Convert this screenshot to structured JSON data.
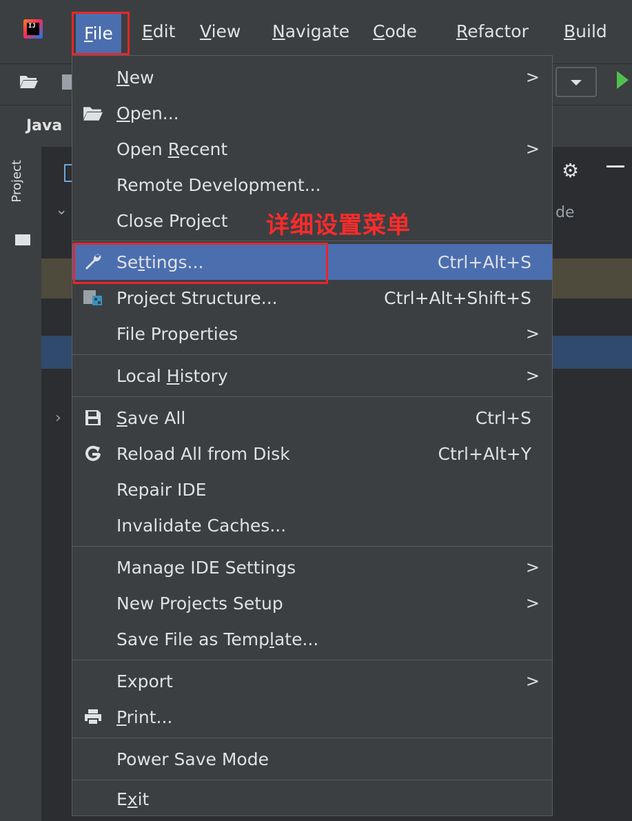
{
  "menubar": {
    "items": [
      {
        "label": "File",
        "underline": "F",
        "rest": "ile"
      },
      {
        "label": "Edit",
        "underline": "E",
        "rest": "dit"
      },
      {
        "label": "View",
        "underline": "V",
        "rest": "iew"
      },
      {
        "label": "Navigate",
        "underline": "N",
        "rest": "avigate"
      },
      {
        "label": "Code",
        "underline": "C",
        "rest": "ode"
      },
      {
        "label": "Refactor",
        "underline": "R",
        "rest": "efactor"
      },
      {
        "label": "Build",
        "underline": "B",
        "rest": "uild"
      }
    ]
  },
  "project_tab": {
    "label": "Java"
  },
  "side_panel": {
    "label": "Project"
  },
  "background_text": {
    "partial": "de"
  },
  "annotation": {
    "text": "详细设置菜单"
  },
  "file_menu": {
    "items": [
      {
        "pre": "",
        "ul": "N",
        "post": "ew",
        "shortcut": "",
        "submenu": true
      },
      {
        "pre": "",
        "ul": "O",
        "post": "pen...",
        "shortcut": "",
        "submenu": false,
        "icon": "folder-open-icon"
      },
      {
        "pre": "Open ",
        "ul": "R",
        "post": "ecent",
        "shortcut": "",
        "submenu": true
      },
      {
        "pre": "Remote Development...",
        "ul": "",
        "post": "",
        "shortcut": "",
        "submenu": false
      },
      {
        "pre": "Close Project",
        "ul": "",
        "post": "",
        "shortcut": "",
        "submenu": false
      },
      {
        "pre": "Se",
        "ul": "t",
        "post": "tings...",
        "shortcut": "Ctrl+Alt+S",
        "submenu": false,
        "icon": "wrench-icon",
        "selected": true
      },
      {
        "pre": "Project Structure...",
        "ul": "",
        "post": "",
        "shortcut": "Ctrl+Alt+Shift+S",
        "submenu": false,
        "icon": "project-structure-icon"
      },
      {
        "pre": "File Properties",
        "ul": "",
        "post": "",
        "shortcut": "",
        "submenu": true
      },
      {
        "pre": "Local ",
        "ul": "H",
        "post": "istory",
        "shortcut": "",
        "submenu": true
      },
      {
        "pre": "",
        "ul": "S",
        "post": "ave All",
        "shortcut": "Ctrl+S",
        "submenu": false,
        "icon": "save-icon"
      },
      {
        "pre": "Reload All from Disk",
        "ul": "",
        "post": "",
        "shortcut": "Ctrl+Alt+Y",
        "submenu": false,
        "icon": "reload-icon"
      },
      {
        "pre": "Repair IDE",
        "ul": "",
        "post": "",
        "shortcut": "",
        "submenu": false
      },
      {
        "pre": "Invalidate Caches...",
        "ul": "",
        "post": "",
        "shortcut": "",
        "submenu": false
      },
      {
        "pre": "Manage IDE Settings",
        "ul": "",
        "post": "",
        "shortcut": "",
        "submenu": true
      },
      {
        "pre": "New Projects Setup",
        "ul": "",
        "post": "",
        "shortcut": "",
        "submenu": true
      },
      {
        "pre": "Save File as Temp",
        "ul": "l",
        "post": "ate...",
        "shortcut": "",
        "submenu": false
      },
      {
        "pre": "Export",
        "ul": "",
        "post": "",
        "shortcut": "",
        "submenu": true
      },
      {
        "pre": "",
        "ul": "P",
        "post": "rint...",
        "shortcut": "",
        "submenu": false,
        "icon": "print-icon"
      },
      {
        "pre": "Power Save Mode",
        "ul": "",
        "post": "",
        "shortcut": "",
        "submenu": false
      },
      {
        "pre": "E",
        "ul": "x",
        "post": "it",
        "shortcut": "",
        "submenu": false
      }
    ],
    "submenu_glyph": ">"
  }
}
